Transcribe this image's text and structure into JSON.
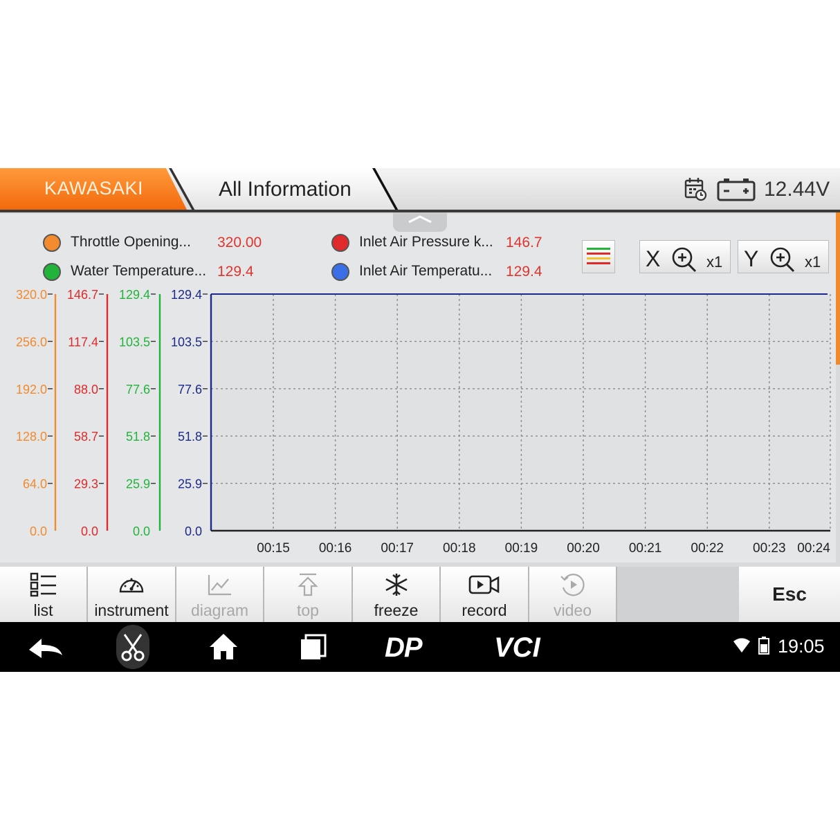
{
  "header": {
    "brand": "KAWASAKI",
    "title": "All Information",
    "voltage": "12.44V",
    "icons": [
      "calendar-clock-icon",
      "battery-icon"
    ]
  },
  "legend": [
    {
      "name": "Throttle Opening...",
      "value": "320.00",
      "color": "#f28a2e"
    },
    {
      "name": "Water Temperature...",
      "value": "129.4",
      "color": "#22b33a"
    },
    {
      "name": "Inlet Air Pressure  k...",
      "value": "146.7",
      "color": "#e02a2a"
    },
    {
      "name": "Inlet Air Temperatu...",
      "value": "129.4",
      "color": "#3b6fe8"
    }
  ],
  "zoom": {
    "x_axis": "X",
    "x_mult": "x1",
    "y_axis": "Y",
    "y_mult": "x1"
  },
  "chart_data": {
    "type": "line",
    "x": [
      "00:15",
      "00:16",
      "00:17",
      "00:18",
      "00:19",
      "00:20",
      "00:21",
      "00:22",
      "00:23",
      "00:24"
    ],
    "grid": true,
    "y_axes": [
      {
        "series": "Throttle Opening...",
        "color": "#f28a2e",
        "ticks": [
          "320.0",
          "256.0",
          "192.0",
          "128.0",
          "64.0",
          "0.0"
        ],
        "ylim": [
          0,
          320
        ]
      },
      {
        "series": "Inlet Air Pressure  k...",
        "color": "#e02a2a",
        "ticks": [
          "146.7",
          "117.4",
          "88.0",
          "58.7",
          "29.3",
          "0.0"
        ],
        "ylim": [
          0,
          146.7
        ]
      },
      {
        "series": "Water Temperature...",
        "color": "#22b33a",
        "ticks": [
          "129.4",
          "103.5",
          "77.6",
          "51.8",
          "25.9",
          "0.0"
        ],
        "ylim": [
          0,
          129.4
        ]
      },
      {
        "series": "Inlet Air Temperatu...",
        "color": "#1b2a8a",
        "ticks": [
          "129.4",
          "103.5",
          "77.6",
          "51.8",
          "25.9",
          "0.0"
        ],
        "ylim": [
          0,
          129.4
        ]
      }
    ]
  },
  "toolbar": {
    "buttons": [
      {
        "label": "list",
        "icon": "list-icon",
        "enabled": true
      },
      {
        "label": "instrument",
        "icon": "gauge-icon",
        "enabled": true
      },
      {
        "label": "diagram",
        "icon": "chart-icon",
        "enabled": false
      },
      {
        "label": "top",
        "icon": "arrow-up-icon",
        "enabled": false
      },
      {
        "label": "freeze",
        "icon": "snowflake-icon",
        "enabled": true
      },
      {
        "label": "record",
        "icon": "video-camera-icon",
        "enabled": true
      },
      {
        "label": "video",
        "icon": "play-history-icon",
        "enabled": false
      }
    ],
    "esc_label": "Esc"
  },
  "navbar": {
    "items": [
      "back-icon",
      "scissors-icon",
      "home-icon",
      "recent-apps-icon",
      "dp-logo",
      "vci-logo"
    ],
    "dp_text": "DP",
    "vci_text": "VCI",
    "time": "19:05"
  }
}
